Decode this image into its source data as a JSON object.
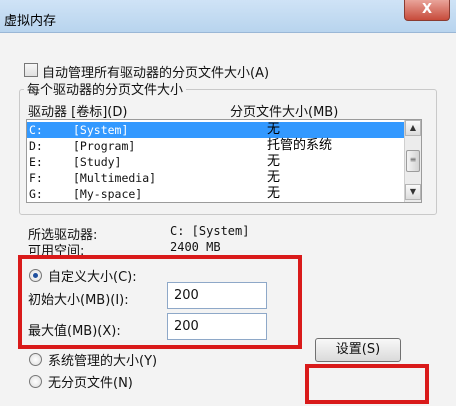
{
  "window": {
    "title": "虚拟内存",
    "close_label": "X"
  },
  "auto_manage": {
    "label": "自动管理所有驱动器的分页文件大小(A)",
    "checked": false
  },
  "group": {
    "title": "每个驱动器的分页文件大小",
    "col_drive": "驱动器 [卷标](D)",
    "col_pagefile": "分页文件大小(MB)"
  },
  "drives": [
    {
      "drive": "C:",
      "label": "[System]",
      "pagefile": "无",
      "selected": true
    },
    {
      "drive": "D:",
      "label": "[Program]",
      "pagefile": "托管的系统",
      "selected": false
    },
    {
      "drive": "E:",
      "label": "[Study]",
      "pagefile": "无",
      "selected": false
    },
    {
      "drive": "F:",
      "label": "[Multimedia]",
      "pagefile": "无",
      "selected": false
    },
    {
      "drive": "G:",
      "label": "[My-space]",
      "pagefile": "无",
      "selected": false
    }
  ],
  "selected_drive": {
    "label": "所选驱动器:",
    "value": "C:  [System]",
    "space_label": "可用空间:",
    "space_value": "2400 MB"
  },
  "custom_size": {
    "label": "自定义大小(C):",
    "initial_label": "初始大小(MB)(I):",
    "initial_value": "200",
    "max_label": "最大值(MB)(X):",
    "max_value": "200"
  },
  "system_managed": {
    "label": "系统管理的大小(Y)"
  },
  "no_paging": {
    "label": "无分页文件(N)"
  },
  "set_button": {
    "label": "设置(S)"
  },
  "selected_option": "custom",
  "colors": {
    "highlight": "#d91a1a",
    "selection": "#3399ff"
  }
}
